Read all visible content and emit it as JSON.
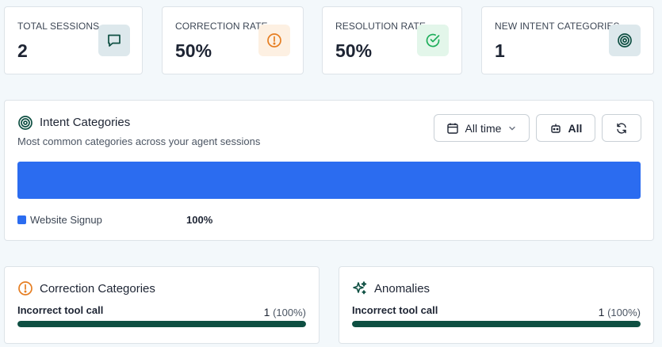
{
  "stats": [
    {
      "label": "TOTAL SESSIONS",
      "value": "2",
      "icon": "chat-icon"
    },
    {
      "label": "CORRECTION RATE",
      "value": "50%",
      "icon": "alert-circle-icon"
    },
    {
      "label": "RESOLUTION RATE",
      "value": "50%",
      "icon": "check-circle-icon"
    },
    {
      "label": "NEW INTENT CATEGORIES",
      "value": "1",
      "icon": "target-icon"
    }
  ],
  "intent": {
    "title": "Intent Categories",
    "subtitle": "Most common categories across your agent sessions",
    "time_filter": "All time",
    "agent_filter": "All",
    "legend": [
      {
        "name": "Website Signup",
        "percent": "100%",
        "share": 1.0,
        "color": "#2b6cf0"
      }
    ]
  },
  "correction": {
    "title": "Correction Categories",
    "items": [
      {
        "label": "Incorrect tool call",
        "count": "1",
        "percent": "(100%)",
        "share": 1.0
      }
    ]
  },
  "anomalies": {
    "title": "Anomalies",
    "items": [
      {
        "label": "Incorrect tool call",
        "count": "1",
        "percent": "(100%)",
        "share": 1.0
      }
    ]
  },
  "colors": {
    "accent_blue": "#2b6cf0",
    "bar_green": "#0e4f42",
    "warning": "#e67e22",
    "success": "#1fae5b",
    "teal": "#0e4f42"
  }
}
